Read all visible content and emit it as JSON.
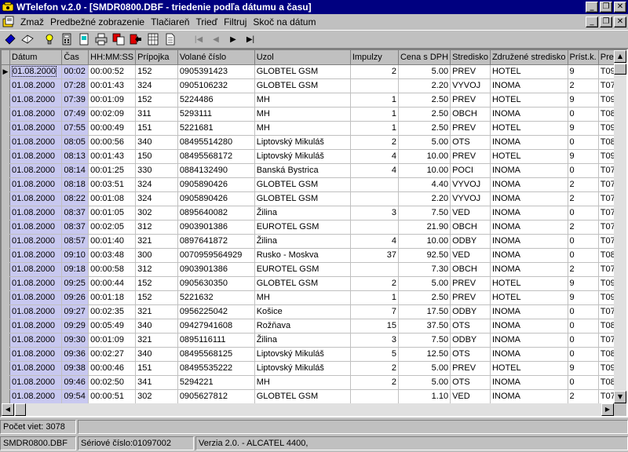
{
  "window": {
    "title": "WTelefon v.2.0 - [SMDR0800.DBF - triedenie podľa dátumu a času]"
  },
  "menu": {
    "items": [
      {
        "label": "Zmaž"
      },
      {
        "label": "Predbežné zobrazenie"
      },
      {
        "label": "Tlačiareň"
      },
      {
        "label": "Trieď"
      },
      {
        "label": "Filtruj"
      },
      {
        "label": "Skoč na dátum"
      }
    ]
  },
  "toolbar": {
    "icons": [
      "open-book-icon",
      "open-folder-icon",
      "bulb-icon",
      "calculator-icon",
      "document-icon",
      "printer-icon",
      "copy-red-icon",
      "arrow-export-icon",
      "grid-icon",
      "page-icon"
    ],
    "nav": [
      "|◀",
      "◀",
      "▶",
      "▶|"
    ]
  },
  "table": {
    "columns": [
      "Dátum",
      "Čas",
      "HH:MM:SS",
      "Prípojka",
      "Volané číslo",
      "Uzol",
      "Impulzy",
      "Cena s DPH",
      "Stredisko",
      "Združené stredisko",
      "Príst.k.",
      "Pre"
    ],
    "rows": [
      [
        "01.08.2000",
        "00:02",
        "00:00:52",
        "152",
        "0905391423",
        "GLOBTEL GSM",
        "2",
        "5.00",
        "PREV",
        "HOTEL",
        "9",
        "T09"
      ],
      [
        "01.08.2000",
        "07:28",
        "00:01:43",
        "324",
        "0905106232",
        "GLOBTEL GSM",
        "",
        "2.20",
        "VYVOJ",
        "INOMA",
        "2",
        "T07"
      ],
      [
        "01.08.2000",
        "07:39",
        "00:01:09",
        "152",
        "5224486",
        "MH",
        "1",
        "2.50",
        "PREV",
        "HOTEL",
        "9",
        "T09"
      ],
      [
        "01.08.2000",
        "07:49",
        "00:02:09",
        "311",
        "5293111",
        "MH",
        "1",
        "2.50",
        "OBCH",
        "INOMA",
        "0",
        "T08"
      ],
      [
        "01.08.2000",
        "07:55",
        "00:00:49",
        "151",
        "5221681",
        "MH",
        "1",
        "2.50",
        "PREV",
        "HOTEL",
        "9",
        "T09"
      ],
      [
        "01.08.2000",
        "08:05",
        "00:00:56",
        "340",
        "08495514280",
        "Liptovský Mikuláš",
        "2",
        "5.00",
        "OTS",
        "INOMA",
        "0",
        "T08"
      ],
      [
        "01.08.2000",
        "08:13",
        "00:01:43",
        "150",
        "08495568172",
        "Liptovský Mikuláš",
        "4",
        "10.00",
        "PREV",
        "HOTEL",
        "9",
        "T09"
      ],
      [
        "01.08.2000",
        "08:14",
        "00:01:25",
        "330",
        "0884132490",
        "Banská Bystrica",
        "4",
        "10.00",
        "POCI",
        "INOMA",
        "0",
        "T07"
      ],
      [
        "01.08.2000",
        "08:18",
        "00:03:51",
        "324",
        "0905890426",
        "GLOBTEL GSM",
        "",
        "4.40",
        "VYVOJ",
        "INOMA",
        "2",
        "T07"
      ],
      [
        "01.08.2000",
        "08:22",
        "00:01:08",
        "324",
        "0905890426",
        "GLOBTEL GSM",
        "",
        "2.20",
        "VYVOJ",
        "INOMA",
        "2",
        "T07"
      ],
      [
        "01.08.2000",
        "08:37",
        "00:01:05",
        "302",
        "0895640082",
        "Žilina",
        "3",
        "7.50",
        "VED",
        "INOMA",
        "0",
        "T07"
      ],
      [
        "01.08.2000",
        "08:37",
        "00:02:05",
        "312",
        "0903901386",
        "EUROTEL GSM",
        "",
        "21.90",
        "OBCH",
        "INOMA",
        "2",
        "T07"
      ],
      [
        "01.08.2000",
        "08:57",
        "00:01:40",
        "321",
        "0897641872",
        "Žilina",
        "4",
        "10.00",
        "ODBY",
        "INOMA",
        "0",
        "T07"
      ],
      [
        "01.08.2000",
        "09:10",
        "00:03:48",
        "300",
        "0070959564929",
        "Rusko - Moskva",
        "37",
        "92.50",
        "VED",
        "INOMA",
        "0",
        "T08"
      ],
      [
        "01.08.2000",
        "09:18",
        "00:00:58",
        "312",
        "0903901386",
        "EUROTEL GSM",
        "",
        "7.30",
        "OBCH",
        "INOMA",
        "2",
        "T07"
      ],
      [
        "01.08.2000",
        "09:25",
        "00:00:44",
        "152",
        "0905630350",
        "GLOBTEL GSM",
        "2",
        "5.00",
        "PREV",
        "HOTEL",
        "9",
        "T09"
      ],
      [
        "01.08.2000",
        "09:26",
        "00:01:18",
        "152",
        "5221632",
        "MH",
        "1",
        "2.50",
        "PREV",
        "HOTEL",
        "9",
        "T09"
      ],
      [
        "01.08.2000",
        "09:27",
        "00:02:35",
        "321",
        "0956225042",
        "Košice",
        "7",
        "17.50",
        "ODBY",
        "INOMA",
        "0",
        "T07"
      ],
      [
        "01.08.2000",
        "09:29",
        "00:05:49",
        "340",
        "09427941608",
        "Rožňava",
        "15",
        "37.50",
        "OTS",
        "INOMA",
        "0",
        "T08"
      ],
      [
        "01.08.2000",
        "09:30",
        "00:01:09",
        "321",
        "0895116111",
        "Žilina",
        "3",
        "7.50",
        "ODBY",
        "INOMA",
        "0",
        "T07"
      ],
      [
        "01.08.2000",
        "09:36",
        "00:02:27",
        "340",
        "08495568125",
        "Liptovský Mikuláš",
        "5",
        "12.50",
        "OTS",
        "INOMA",
        "0",
        "T08"
      ],
      [
        "01.08.2000",
        "09:38",
        "00:00:46",
        "151",
        "08495535222",
        "Liptovský Mikuláš",
        "2",
        "5.00",
        "PREV",
        "HOTEL",
        "9",
        "T09"
      ],
      [
        "01.08.2000",
        "09:46",
        "00:02:50",
        "341",
        "5294221",
        "MH",
        "2",
        "5.00",
        "OTS",
        "INOMA",
        "0",
        "T08"
      ],
      [
        "01.08.2000",
        "09:54",
        "00:00:51",
        "302",
        "0905627812",
        "GLOBTEL GSM",
        "",
        "1.10",
        "VED",
        "INOMA",
        "2",
        "T07"
      ]
    ]
  },
  "status": {
    "count": "Počet viet: 3078",
    "file": "SMDR0800.DBF",
    "serial": "Sériové číslo:01097002",
    "version": "Verzia 2.0. - ALCATEL 4400,"
  }
}
